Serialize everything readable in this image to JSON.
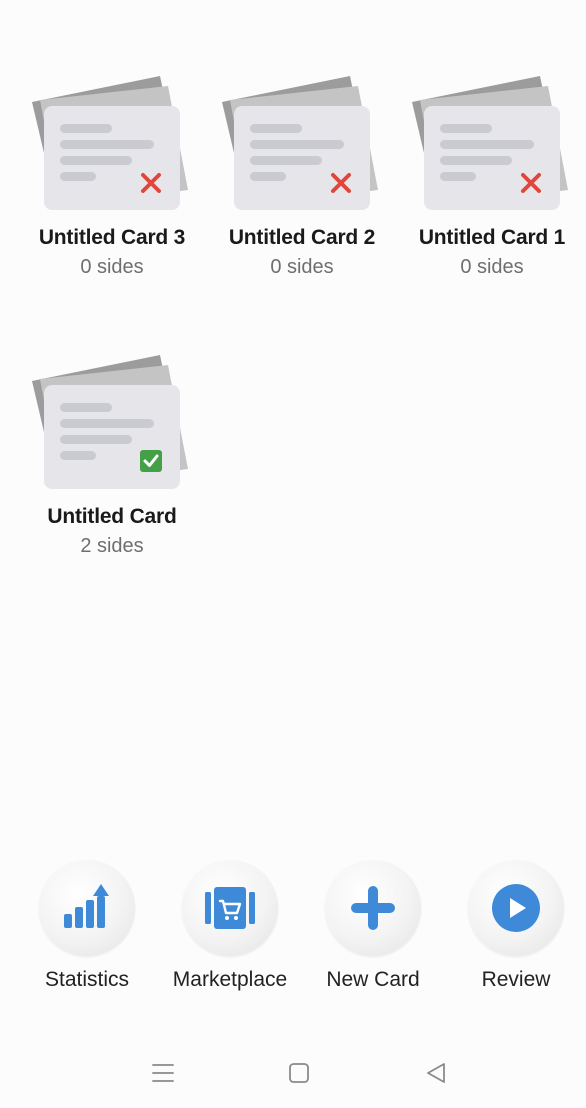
{
  "decks": [
    {
      "title": "Untitled Card 3",
      "sides": "0 sides",
      "status": "incomplete",
      "status_icon": "red-x-icon"
    },
    {
      "title": "Untitled Card 2",
      "sides": "0 sides",
      "status": "incomplete",
      "status_icon": "red-x-icon"
    },
    {
      "title": "Untitled Card 1",
      "sides": "0 sides",
      "status": "incomplete",
      "status_icon": "red-x-icon"
    },
    {
      "title": "Untitled Card",
      "sides": "2 sides",
      "status": "complete",
      "status_icon": "green-check-icon"
    }
  ],
  "actions": [
    {
      "label": "Statistics",
      "icon": "bar-chart-up-icon"
    },
    {
      "label": "Marketplace",
      "icon": "shop-cart-icon"
    },
    {
      "label": "New Card",
      "icon": "plus-icon"
    },
    {
      "label": "Review",
      "icon": "play-icon"
    }
  ],
  "navbar": {
    "menu_icon": "menu-icon",
    "home_icon": "home-square-icon",
    "back_icon": "back-triangle-icon"
  },
  "colors": {
    "accent": "#3f8ad8",
    "error": "#e0473c",
    "success": "#43a047",
    "background": "#fcfcfc"
  }
}
